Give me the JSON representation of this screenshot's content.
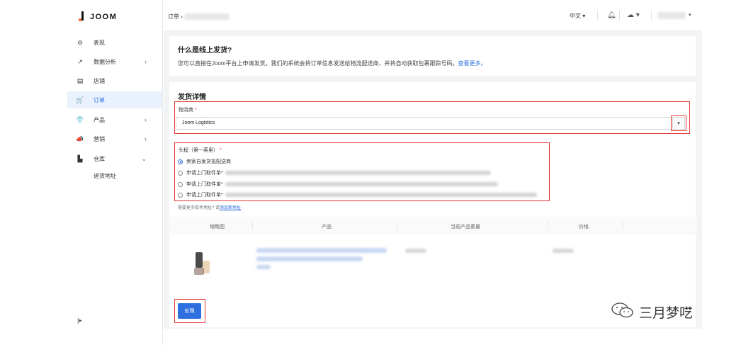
{
  "brand": {
    "name": "JOOM"
  },
  "sidebar": {
    "items": [
      {
        "label": "表现",
        "icon": "dashboard-icon",
        "glyph": "⊖",
        "has_chevron": false
      },
      {
        "label": "数据分析",
        "icon": "analytics-icon",
        "glyph": "↗",
        "has_chevron": true
      },
      {
        "label": "店铺",
        "icon": "store-icon",
        "glyph": "▤",
        "has_chevron": false
      },
      {
        "label": "订单",
        "icon": "cart-icon",
        "glyph": "🛒",
        "has_chevron": false,
        "active": true
      },
      {
        "label": "产品",
        "icon": "shirt-icon",
        "glyph": "👕",
        "has_chevron": true
      },
      {
        "label": "营销",
        "icon": "megaphone-icon",
        "glyph": "📣",
        "has_chevron": true
      },
      {
        "label": "仓库",
        "icon": "warehouse-icon",
        "glyph": "▙",
        "has_chevron": true,
        "expanded": true
      }
    ],
    "sub_items": [
      {
        "label": "退货地址"
      }
    ],
    "collapse_glyph": "|▸"
  },
  "topbar": {
    "breadcrumb_root": "订单",
    "breadcrumb_sep": "›",
    "language": "中文 ▾",
    "caret": "▾"
  },
  "online_shipping": {
    "title": "什么是线上发货?",
    "description": "您可以直接在Joom平台上申请发货。我们的系统会将订单信息发送给物流配送商，并将自动获取包裹跟踪号码。",
    "learn_more": "查看更多。"
  },
  "shipping_details": {
    "title": "发货详情",
    "carrier_label": "物流商",
    "carrier_required": "*",
    "carrier_value": "Joom Logistics",
    "carrier_caret": "▾",
    "first_mile_label": "头程（第一英里）",
    "first_mile_required": "*",
    "options": [
      {
        "label": "卖家自发货抵配送商",
        "selected": true
      },
      {
        "label": "申请上门取件单*",
        "selected": false
      },
      {
        "label": "申请上门取件单*",
        "selected": false
      },
      {
        "label": "申请上门取件单*",
        "selected": false
      }
    ],
    "hint_text": "需要更多取件地址? 请",
    "hint_link": "添加新地址"
  },
  "table": {
    "headers": [
      "缩略图",
      "产品",
      "当前产品重量",
      "价格"
    ]
  },
  "submit_label": "处理",
  "watermark": {
    "text": "三月梦呓"
  }
}
